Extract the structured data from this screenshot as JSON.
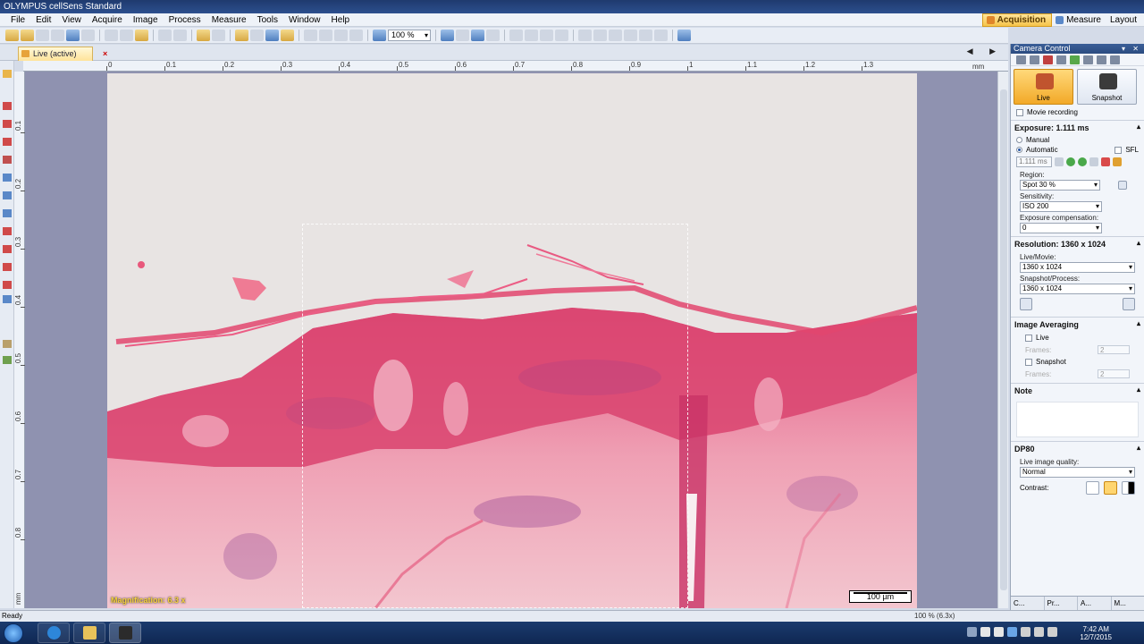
{
  "window": {
    "title": "OLYMPUS cellSens Standard"
  },
  "menu": [
    "File",
    "Edit",
    "View",
    "Acquire",
    "Image",
    "Process",
    "Measure",
    "Tools",
    "Window",
    "Help"
  ],
  "layouts": [
    {
      "label": "Acquisition",
      "active": true
    },
    {
      "label": "Measure",
      "active": false
    },
    {
      "label": "Layout",
      "active": false
    }
  ],
  "toolbar": {
    "zoom_value": "100 %"
  },
  "document": {
    "tab_label": "Live (active)",
    "close_glyph": "×",
    "nav_arrows": "◀ ▶"
  },
  "ruler": {
    "top_labels": [
      "0",
      "0.1",
      "0.2",
      "0.3",
      "0.4",
      "0.5",
      "0.6",
      "0.7",
      "0.8",
      "0.9",
      "1",
      "1.1",
      "1.2",
      "1.3"
    ],
    "top_unit": "mm",
    "left_labels": [
      "0.1",
      "0.2",
      "0.3",
      "0.4",
      "0.5",
      "0.6",
      "0.7",
      "0.8"
    ],
    "left_unit": "mm"
  },
  "image": {
    "magnification_label": "Magnification:",
    "magnification_value": "6.3 x",
    "scalebar_label": "100 µm"
  },
  "camera_control": {
    "title": "Camera Control",
    "live_label": "Live",
    "snapshot_label": "Snapshot",
    "movie_recording_label": "Movie recording",
    "exposure_header": "Exposure: 1.111 ms",
    "manual_label": "Manual",
    "automatic_label": "Automatic",
    "sfl_label": "SFL",
    "exposure_value": "1.111 ms",
    "region_label": "Region:",
    "region_value": "Spot 30 %",
    "sensitivity_label": "Sensitivity:",
    "sensitivity_value": "ISO 200",
    "exposure_comp_label": "Exposure compensation:",
    "exposure_comp_value": "0",
    "resolution_header": "Resolution: 1360 x 1024",
    "live_movie_label": "Live/Movie:",
    "live_movie_value": "1360 x 1024",
    "snapshot_process_label": "Snapshot/Process:",
    "snapshot_process_value": "1360 x 1024",
    "image_averaging_header": "Image Averaging",
    "avg_live_label": "Live",
    "avg_live_frames_label": "Frames:",
    "avg_live_frames": "2",
    "avg_snapshot_label": "Snapshot",
    "avg_snapshot_frames_label": "Frames:",
    "avg_snapshot_frames": "2",
    "note_header": "Note",
    "dp80_header": "DP80",
    "live_quality_label": "Live image quality:",
    "live_quality_value": "Normal",
    "contrast_label": "Contrast:",
    "bottom_tabs": [
      "C...",
      "Pr...",
      "A...",
      "M..."
    ]
  },
  "status": {
    "left": "Ready",
    "zoom": "100 % (6.3x)"
  },
  "taskbar": {
    "time": "7:42 AM",
    "date": "12/7/2015"
  },
  "colors": {
    "accent": "#f6c44a",
    "titlebar": "#2c4f8e",
    "canvas_bg": "#8f92b0",
    "stain_pink": "#e8507a"
  }
}
